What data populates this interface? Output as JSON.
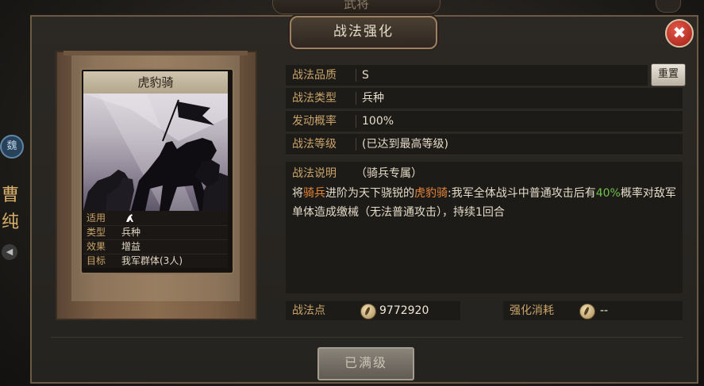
{
  "top_tab": {
    "label": "武将"
  },
  "left_strip": {
    "faction": "魏",
    "name_chars": [
      "曹",
      "纯"
    ]
  },
  "dialog": {
    "title": "战法强化",
    "close": "✖"
  },
  "card": {
    "title": "虎豹骑",
    "stats": [
      {
        "key": "适用",
        "value": ""
      },
      {
        "key": "类型",
        "value": "兵种"
      },
      {
        "key": "效果",
        "value": "增益"
      },
      {
        "key": "目标",
        "value": "我军群体(3人)"
      }
    ]
  },
  "info": {
    "quality": {
      "key": "战法品质",
      "value": "S"
    },
    "type": {
      "key": "战法类型",
      "value": "兵种"
    },
    "rate": {
      "key": "发动概率",
      "value": "100%"
    },
    "level": {
      "key": "战法等级",
      "value": "(已达到最高等级)"
    },
    "reset_label": "重置"
  },
  "description": {
    "key": "战法说明",
    "tag": "（骑兵专属）",
    "parts": [
      "将",
      "骑兵",
      "进阶为天下骁锐的",
      "虎豹骑",
      ":我军全体战斗中普通攻击后有",
      "40%",
      "概率对敌军单体造成缴械（无法普通攻击），持续1回合"
    ]
  },
  "points": {
    "key": "战法点",
    "value": "9772920"
  },
  "cost": {
    "key": "强化消耗",
    "value": "--"
  },
  "button": {
    "label": "已满级"
  },
  "colors": {
    "accent_gold": "#c9a46a",
    "highlight_orange": "#e8873a",
    "highlight_green": "#6fc14b",
    "close_red": "#c0281c"
  }
}
